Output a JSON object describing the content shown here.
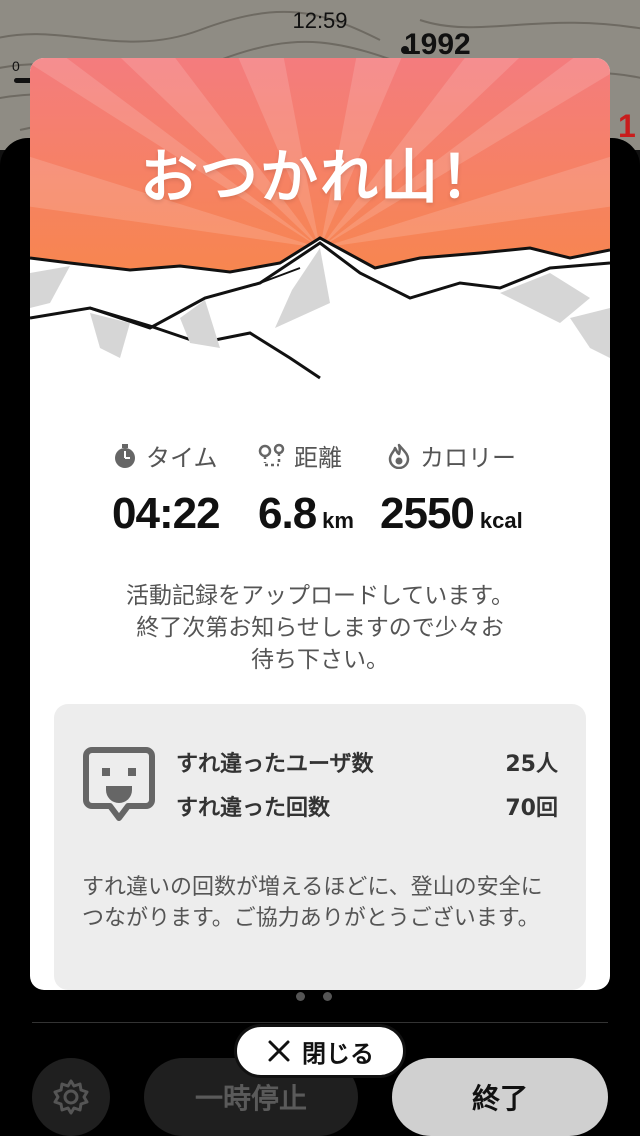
{
  "status_bar": {
    "time": "12:59"
  },
  "map": {
    "elevation_label": "1992",
    "scale_zero": "0",
    "edge_text": "1"
  },
  "modal": {
    "title": "おつかれ山！",
    "stats": {
      "time": {
        "label": "タイム",
        "value": "04:22",
        "unit": ""
      },
      "distance": {
        "label": "距離",
        "value": "6.8",
        "unit": "km"
      },
      "calories": {
        "label": "カロリー",
        "value": "2550",
        "unit": "kcal"
      }
    },
    "upload_message": "活動記録をアップロードしています。\n終了次第お知らせしますので少々お\n待ち下さい。",
    "passing": {
      "users_label": "すれ違ったユーザ数",
      "users_value": "25人",
      "count_label": "すれ違った回数",
      "count_value": "70回",
      "note": "すれ違いの回数が増えるほどに、登山の安全につながります。ご協力ありがとうございます。"
    },
    "colors": {
      "hero_top": "#f47b7b",
      "hero_bottom": "#f88a3c",
      "ray": "#ffb27a"
    }
  },
  "close_button": {
    "label": "閉じる",
    "icon": "close-icon"
  },
  "controls": {
    "settings_icon": "gear-icon",
    "pause_label": "一時停止",
    "end_label": "終了"
  }
}
